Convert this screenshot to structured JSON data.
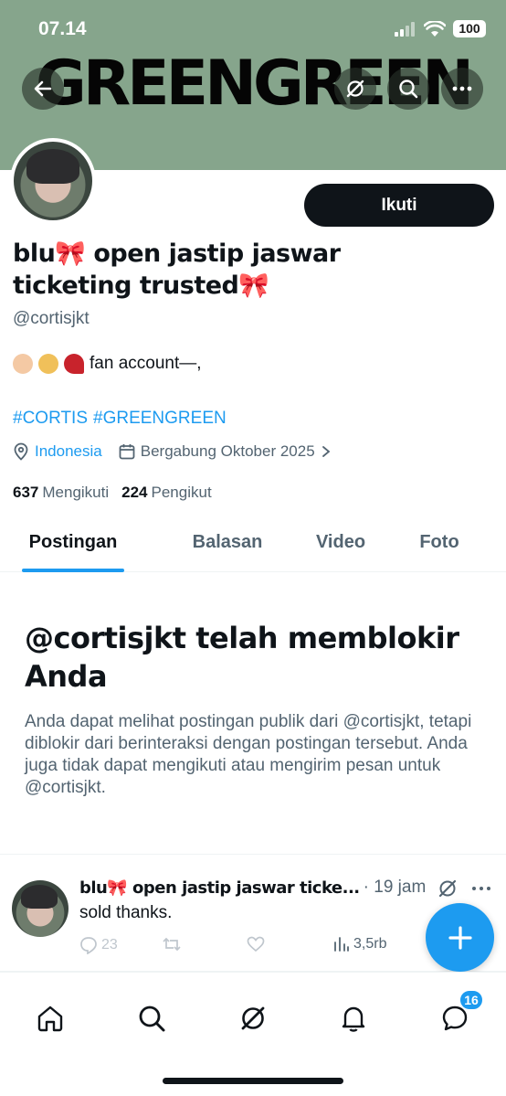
{
  "status_bar": {
    "time": "07.14",
    "battery": "100"
  },
  "banner": {
    "text": "GREENGREEN"
  },
  "profile": {
    "name": "blu🎀 open jastip jaswar ticketing trusted🎀",
    "handle": "@cortisjkt",
    "bio_text": "fan account—,",
    "hashtags": [
      "#CORTIS",
      "#GREENGREEN"
    ],
    "location": "Indonesia",
    "joined": "Bergabung Oktober 2025",
    "following_count": "637",
    "following_label": "Mengikuti",
    "followers_count": "224",
    "followers_label": "Pengikut",
    "follow_button": "Ikuti"
  },
  "tabs": [
    {
      "label": "Postingan",
      "active": true
    },
    {
      "label": "Balasan",
      "active": false
    },
    {
      "label": "Video",
      "active": false
    },
    {
      "label": "Foto",
      "active": false
    }
  ],
  "blocked": {
    "title": "@cortisjkt telah memblokir Anda",
    "description": "Anda dapat melihat postingan publik dari @cortisjkt, tetapi diblokir dari berinteraksi dengan postingan tersebut. Anda juga tidak dapat mengikuti atau mengirim pesan untuk @cortisjkt."
  },
  "tweet": {
    "name": "blu🎀 open jastip jaswar ticke...",
    "time": "· 19 jam",
    "text": "sold thanks.",
    "replies": "23",
    "views": "3,5rb"
  },
  "bottom_nav": {
    "messages_badge": "16"
  },
  "colors": {
    "accent": "#1d9bf0",
    "banner": "#86a58c",
    "text": "#0f1419",
    "muted": "#536471"
  }
}
